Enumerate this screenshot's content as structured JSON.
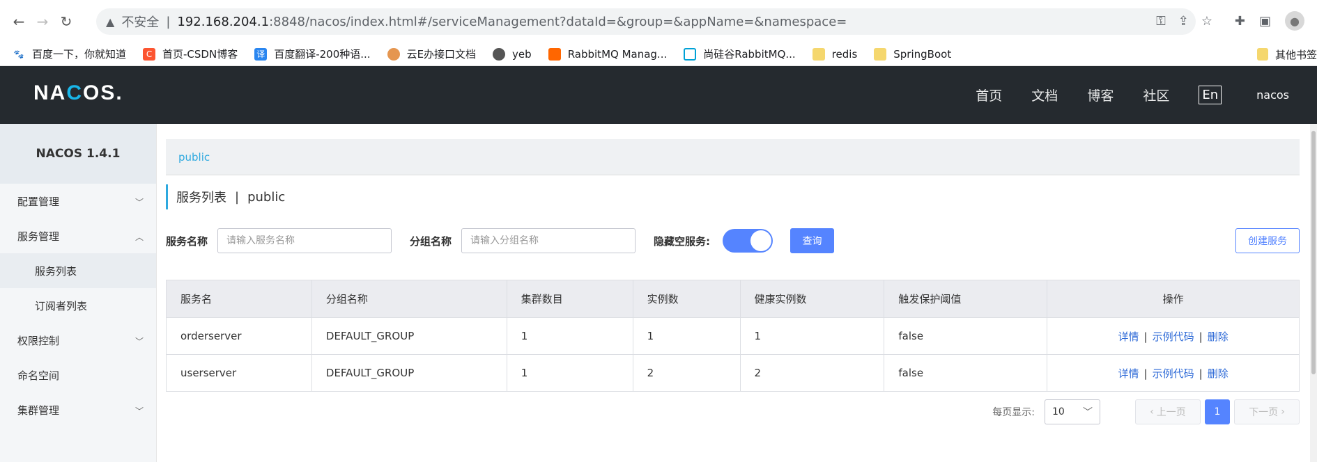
{
  "browser": {
    "url_warning": "不安全",
    "url_host": "192.168.204.1",
    "url_rest": ":8848/nacos/index.html#/serviceManagement?dataId=&group=&appName=&namespace=",
    "bookmarks": [
      {
        "label": "百度一下，你就知道",
        "color": "#2932e1",
        "glyph": "🐾"
      },
      {
        "label": "首页-CSDN博客",
        "color": "#fc5531",
        "glyph": "C"
      },
      {
        "label": "百度翻译-200种语...",
        "color": "#2a86f0",
        "glyph": "译"
      },
      {
        "label": "云E办接口文档",
        "color": "#e59650",
        "glyph": "◉"
      },
      {
        "label": "yeb",
        "color": "#555555",
        "glyph": "◎"
      },
      {
        "label": "RabbitMQ Manag...",
        "color": "#ff6600",
        "glyph": "▙"
      },
      {
        "label": "尚硅谷RabbitMQ...",
        "color": "#00a1d6",
        "glyph": "▣"
      },
      {
        "label": "redis",
        "color": "#f5d76e",
        "glyph": ""
      },
      {
        "label": "SpringBoot",
        "color": "#f5d76e",
        "glyph": ""
      }
    ],
    "other_bookmarks": "其他书签"
  },
  "header": {
    "logo_a": "NA",
    "logo_accent": "C",
    "logo_b": "OS.",
    "nav": [
      "首页",
      "文档",
      "博客",
      "社区"
    ],
    "lang": "En",
    "user": "nacos"
  },
  "sidebar": {
    "version": "NACOS 1.4.1",
    "config": "配置管理",
    "service": "服务管理",
    "service_list": "服务列表",
    "subscribers": "订阅者列表",
    "auth": "权限控制",
    "namespace": "命名空间",
    "cluster": "集群管理"
  },
  "main": {
    "namespace": "public",
    "title": "服务列表",
    "title_sep": "|",
    "title_ns": "public",
    "filter": {
      "service_label": "服务名称",
      "service_placeholder": "请输入服务名称",
      "group_label": "分组名称",
      "group_placeholder": "请输入分组名称",
      "hide_empty_label": "隐藏空服务:",
      "query": "查询",
      "create": "创建服务"
    },
    "table": {
      "headers": [
        "服务名",
        "分组名称",
        "集群数目",
        "实例数",
        "健康实例数",
        "触发保护阈值",
        "操作"
      ],
      "rows": [
        [
          "orderserver",
          "DEFAULT_GROUP",
          "1",
          "1",
          "1",
          "false"
        ],
        [
          "userserver",
          "DEFAULT_GROUP",
          "1",
          "2",
          "2",
          "false"
        ]
      ],
      "op_detail": "详情",
      "op_sample": "示例代码",
      "op_delete": "删除",
      "op_sep": "|"
    },
    "pager": {
      "per_page_label": "每页显示:",
      "per_page": "10",
      "prev": "上一页",
      "next": "下一页",
      "current": "1"
    }
  }
}
